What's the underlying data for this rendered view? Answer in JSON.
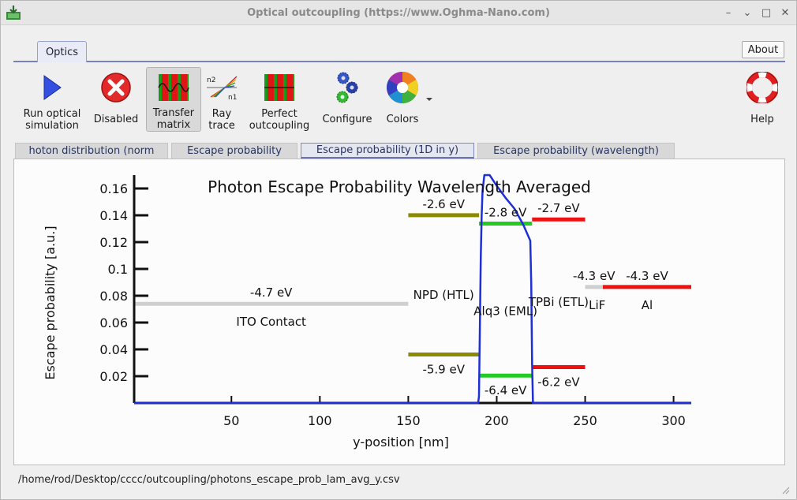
{
  "window": {
    "title": "Optical outcoupling (https://www.Oghma-Nano.com)",
    "buttons": [
      "–",
      "⌄",
      "□",
      "✕"
    ]
  },
  "ribbon": {
    "tab_label": "Optics",
    "about_label": "About"
  },
  "toolbar": {
    "run": "Run optical\nsimulation",
    "disabled": "Disabled",
    "transfer": "Transfer\nmatrix",
    "ray": "Ray\ntrace",
    "perfect": "Perfect\noutcoupling",
    "configure": "Configure",
    "colors": "Colors",
    "help": "Help",
    "ray_n2": "n2",
    "ray_n1": "n1"
  },
  "tabs": [
    {
      "label": "hoton distribution (norm"
    },
    {
      "label": "Escape probability"
    },
    {
      "label": "Escape probability (1D in y)"
    },
    {
      "label": "Escape probability (wavelength)"
    }
  ],
  "status": {
    "path": "/home/rod/Desktop/cccc/outcoupling/photons_escape_prob_lam_avg_y.csv"
  },
  "colors": {
    "curve": "#1f2fd6",
    "ito": "#cfcfcf",
    "npd": "#8c8a00",
    "alq3": "#22cc22",
    "tpbi": "#ee1111",
    "lif": "#cfcfcf",
    "al": "#ee1111"
  },
  "chart_data": {
    "type": "line",
    "title": "Photon Escape Probability Wavelength Averaged",
    "xlabel": "y-position [nm]",
    "ylabel": "Escape probability [a.u.]",
    "xlim": [
      -5,
      310
    ],
    "ylim": [
      0,
      0.17
    ],
    "xticks": [
      50,
      100,
      150,
      200,
      250,
      300
    ],
    "yticks": [
      0.02,
      0.04,
      0.06,
      0.08,
      0.1,
      0.12,
      0.14,
      0.16
    ],
    "series": [
      {
        "x": [
          -5,
          189.5,
          190,
          190.5,
          191,
          191.5,
          192,
          193,
          196,
          200,
          205,
          210,
          215,
          219,
          219.5,
          220,
          220.5,
          300,
          310
        ],
        "y": [
          0,
          0,
          0.005,
          0.06,
          0.11,
          0.14,
          0.158,
          0.17,
          0.17,
          0.162,
          0.153,
          0.145,
          0.133,
          0.121,
          0.09,
          0.03,
          0,
          0,
          0
        ]
      }
    ],
    "bands": [
      {
        "key": "ito",
        "x": [
          -5,
          150
        ],
        "lumo": -4.7,
        "homo": null,
        "lumo_label": "-4.7 eV",
        "homo_label": "",
        "name": "ITO Contact"
      },
      {
        "key": "npd",
        "x": [
          150,
          190
        ],
        "lumo": -2.6,
        "homo": -5.9,
        "lumo_label": "-2.6 eV",
        "homo_label": "-5.9 eV",
        "name": "NPD (HTL)"
      },
      {
        "key": "alq3",
        "x": [
          190,
          220
        ],
        "lumo": -2.8,
        "homo": -6.4,
        "lumo_label": "-2.8 eV",
        "homo_label": "-6.4 eV",
        "name": "Alq3 (EML)"
      },
      {
        "key": "tpbi",
        "x": [
          220,
          250
        ],
        "lumo": -2.7,
        "homo": -6.2,
        "lumo_label": "-2.7 eV",
        "homo_label": "-6.2 eV",
        "name": "TPBi (ETL)"
      },
      {
        "key": "lif",
        "x": [
          250,
          260
        ],
        "lumo": -4.3,
        "homo": null,
        "lumo_label": "-4.3 eV",
        "homo_label": "",
        "name": "LiF"
      },
      {
        "key": "al",
        "x": [
          260,
          310
        ],
        "lumo": -4.3,
        "homo": null,
        "lumo_label": "-4.3 eV",
        "homo_label": "",
        "name": "Al"
      }
    ]
  }
}
